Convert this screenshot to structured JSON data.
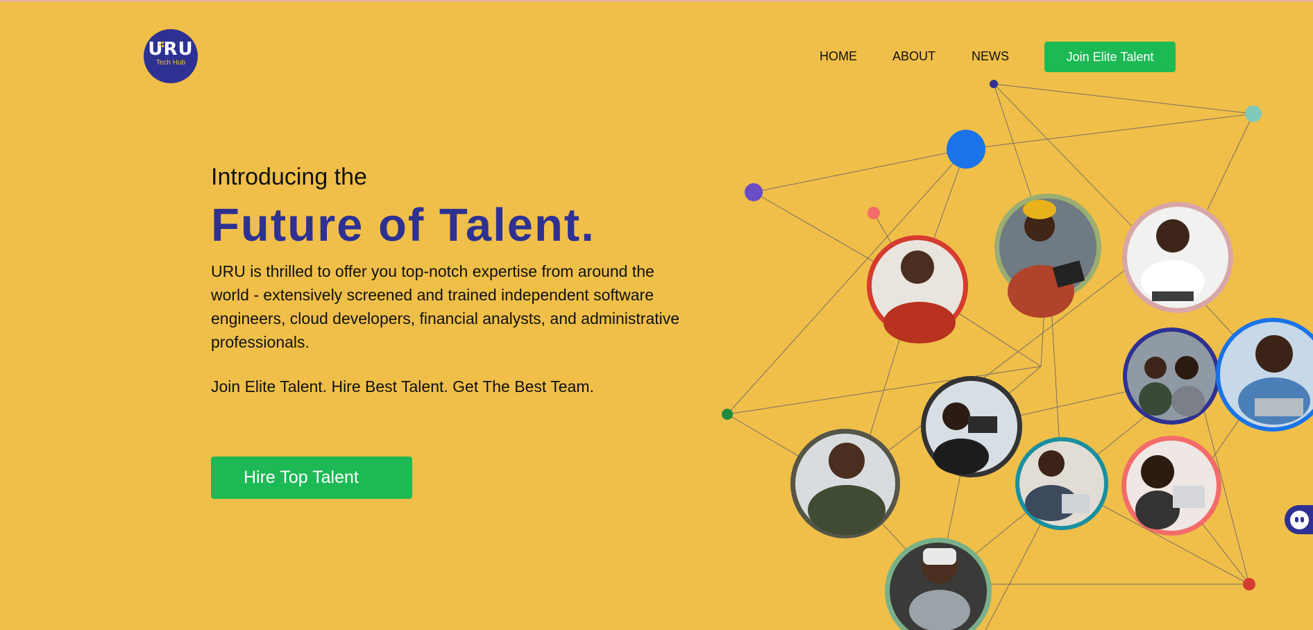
{
  "brand": {
    "logo_mark": "URU",
    "logo_sub": "Tech Hub",
    "colors": {
      "navy": "#2e3192",
      "background": "#efbf49",
      "green": "#1db954"
    }
  },
  "nav": {
    "items": [
      "HOME",
      "ABOUT",
      "NEWS"
    ],
    "cta": "Join Elite Talent"
  },
  "hero": {
    "intro": "Introducing the",
    "headline": "Future of Talent.",
    "description": "URU is thrilled to offer you top-notch expertise from around the world - extensively screened and trained independent software engineers, cloud developers, financial analysts, and administrative professionals.",
    "tagline": "Join Elite Talent. Hire Best Talent. Get The Best Team.",
    "cta": "Hire Top Talent"
  },
  "network": {
    "photos": [
      {
        "name": "man-with-phone-red-shirt",
        "ring": "#d63b2f"
      },
      {
        "name": "woman-headwrap-laptop",
        "ring": "#9aad72"
      },
      {
        "name": "boy-soldering",
        "ring": "#d9a6a8"
      },
      {
        "name": "coworkers-tablet",
        "ring": "#2e3192"
      },
      {
        "name": "man-headphones-laptop",
        "ring": "#1a73e8"
      },
      {
        "name": "man-video-camera",
        "ring": "#333333"
      },
      {
        "name": "man-glasses-arms-crossed",
        "ring": "#555548"
      },
      {
        "name": "man-plaid-laptop",
        "ring": "#1a8fa0"
      },
      {
        "name": "woman-laptop-coffee",
        "ring": "#f36c6a"
      },
      {
        "name": "person-vr-headset",
        "ring": "#79b08a"
      }
    ],
    "dot_colors": [
      "#2e3192",
      "#80c8b8",
      "#1a73e8",
      "#6a4cc7",
      "#f36c6a",
      "#1e8c3e",
      "#d63b2f"
    ]
  },
  "chat": {
    "icon": "chat-bot-icon"
  }
}
